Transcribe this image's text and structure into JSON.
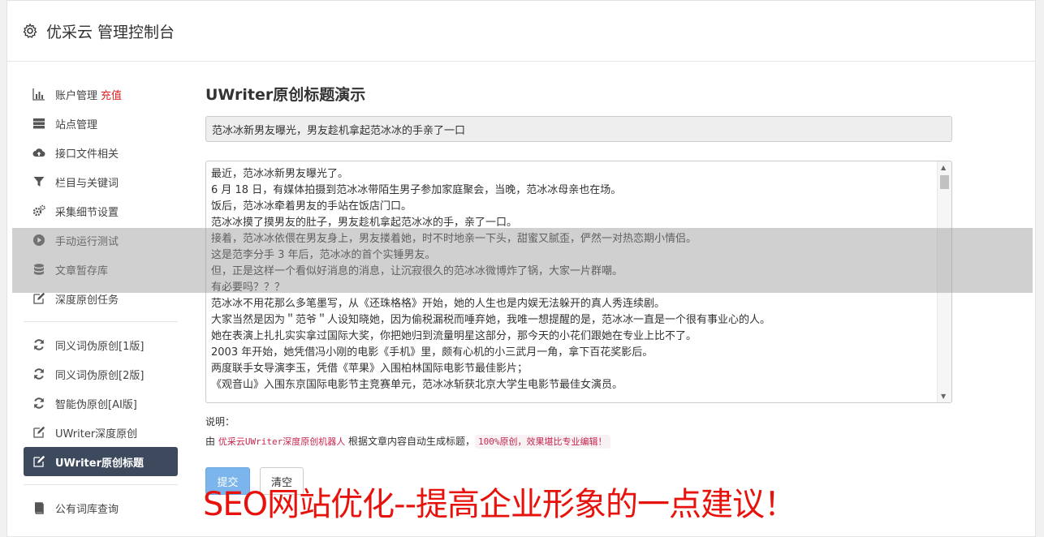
{
  "header": {
    "title": "优采云 管理控制台",
    "icon": "gear-icon"
  },
  "sidebar": {
    "items": [
      {
        "label": "账户管理",
        "badge": "充值",
        "icon": "bar-chart-icon"
      },
      {
        "label": "站点管理",
        "icon": "server-icon"
      },
      {
        "label": "接口文件相关",
        "icon": "cloud-upload-icon"
      },
      {
        "label": "栏目与关键词",
        "icon": "filter-icon"
      },
      {
        "label": "采集细节设置",
        "icon": "gears-icon"
      },
      {
        "label": "手动运行测试",
        "icon": "play-circle-icon"
      },
      {
        "label": "文章暂存库",
        "icon": "database-icon"
      },
      {
        "label": "深度原创任务",
        "icon": "edit-icon"
      },
      {
        "label": "同义词伪原创[1版]",
        "icon": "refresh-icon"
      },
      {
        "label": "同义词伪原创[2版]",
        "icon": "refresh-icon"
      },
      {
        "label": "智能伪原创[AI版]",
        "icon": "refresh-icon"
      },
      {
        "label": "UWriter深度原创",
        "icon": "edit-icon"
      },
      {
        "label": "UWriter原创标题",
        "icon": "edit-icon",
        "active": true
      },
      {
        "label": "公有词库查询",
        "icon": "book-icon"
      }
    ]
  },
  "main": {
    "title": "UWriter原创标题演示",
    "title_input_value": "范冰冰新男友曝光，男友趁机拿起范冰冰的手亲了一口",
    "content_lines": [
      "最近，范冰冰新男友曝光了。",
      "6 月 18 日，有媒体拍摄到范冰冰带陌生男子参加家庭聚会，当晚，范冰冰母亲也在场。",
      "饭后，范冰冰牵着男友的手站在饭店门口。",
      "范冰冰摸了摸男友的肚子，男友趁机拿起范冰冰的手，亲了一口。",
      "接着，范冰冰依偎在男友身上，男友搂着她，时不时地亲一下头，甜蜜又腻歪，俨然一对热恋期小情侣。",
      "这是范李分手 3 年后，范冰冰的首个实锤男友。",
      "但，正是这样一个看似好消息的消息，让沉寂很久的范冰冰微博炸了锅，大家一片群嘲。",
      "有必要吗？？？",
      "范冰冰不用花那么多笔墨写，从《还珠格格》开始，她的人生也是内娱无法躲开的真人秀连续剧。",
      "大家当然是因为＂范爷＂人设知晓她，因为偷税漏税而唾弃她，我唯一想提醒的是，范冰冰一直是一个很有事业心的人。",
      "她在表演上扎扎实实拿过国际大奖，你把她归到流量明星这部分，那今天的小花们跟她在专业上比不了。",
      "2003 年开始，她凭借冯小刚的电影《手机》里，颇有心机的小三武月一角，拿下百花奖影后。",
      "两度联手女导演李玉，凭借《苹果》入围柏林国际电影节最佳影片；",
      "《观音山》入围东京国际电影节主竞赛单元，范冰冰斩获北京大学生电影节最佳女演员。"
    ],
    "note_label": "说明：",
    "note_prefix": "由",
    "note_product": "优采云UWriter深度原创机器人",
    "note_middle": "根据文章内容自动生成标题，",
    "note_highlight": "100%原创，效果堪比专业编辑！",
    "submit_label": "提交",
    "clear_label": "清空"
  },
  "banner": {
    "text": "SEO网站优化--提高企业形象的一点建议！",
    "color": "#e8120c"
  }
}
